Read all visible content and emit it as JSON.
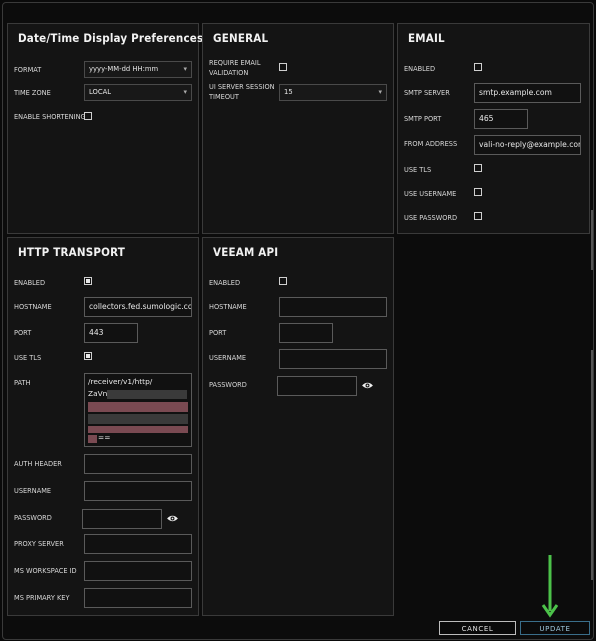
{
  "datetime": {
    "title": "Date/Time Display Preferences",
    "format_label": "FORMAT",
    "format_value": "yyyy-MM-dd HH:mm",
    "timezone_label": "TIME ZONE",
    "timezone_value": "LOCAL",
    "shortening_label": "ENABLE SHORTENING",
    "shortening_checked": false
  },
  "general": {
    "title": "GENERAL",
    "require_email_label_1": "REQUIRE EMAIL",
    "require_email_label_2": "VALIDATION",
    "require_email_checked": false,
    "session_timeout_label_1": "UI SERVER SESSION",
    "session_timeout_label_2": "TIMEOUT",
    "session_timeout_value": "15"
  },
  "email": {
    "title": "EMAIL",
    "enabled_label": "ENABLED",
    "enabled_checked": false,
    "smtp_server_label": "SMTP SERVER",
    "smtp_server_value": "smtp.example.com",
    "smtp_port_label": "SMTP PORT",
    "smtp_port_value": "465",
    "from_address_label": "FROM ADDRESS",
    "from_address_value": "vali-no-reply@example.com",
    "use_tls_label": "USE TLS",
    "use_tls_checked": false,
    "use_username_label": "USE USERNAME",
    "use_username_checked": false,
    "use_password_label": "USE PASSWORD",
    "use_password_checked": false
  },
  "http": {
    "title": "HTTP TRANSPORT",
    "enabled_label": "ENABLED",
    "enabled_checked": true,
    "hostname_label": "HOSTNAME",
    "hostname_value": "collectors.fed.sumologic.com",
    "port_label": "PORT",
    "port_value": "443",
    "use_tls_label": "USE TLS",
    "use_tls_checked": true,
    "path_label": "PATH",
    "path_line1": "/receiver/v1/http/",
    "path_line2": "ZaVn",
    "path_line5": "==",
    "auth_header_label": "AUTH HEADER",
    "auth_header_value": "",
    "username_label": "USERNAME",
    "username_value": "",
    "password_label": "PASSWORD",
    "password_value": "",
    "proxy_label": "PROXY SERVER",
    "proxy_value": "",
    "workspace_label": "MS WORKSPACE ID",
    "workspace_value": "",
    "primary_key_label": "MS PRIMARY KEY",
    "primary_key_value": ""
  },
  "veeam": {
    "title": "VEEAM API",
    "enabled_label": "ENABLED",
    "enabled_checked": false,
    "hostname_label": "HOSTNAME",
    "hostname_value": "",
    "port_label": "PORT",
    "port_value": "",
    "username_label": "USERNAME",
    "username_value": "",
    "password_label": "PASSWORD",
    "password_value": ""
  },
  "footer": {
    "cancel_label": "CANCEL",
    "update_label": "UPDATE"
  },
  "colors": {
    "background": "#0a0a0a",
    "panel": "#141414",
    "border": "#3a3a3a",
    "annotation_arrow": "#4cc24a",
    "update_accent": "#3a6e8a"
  }
}
